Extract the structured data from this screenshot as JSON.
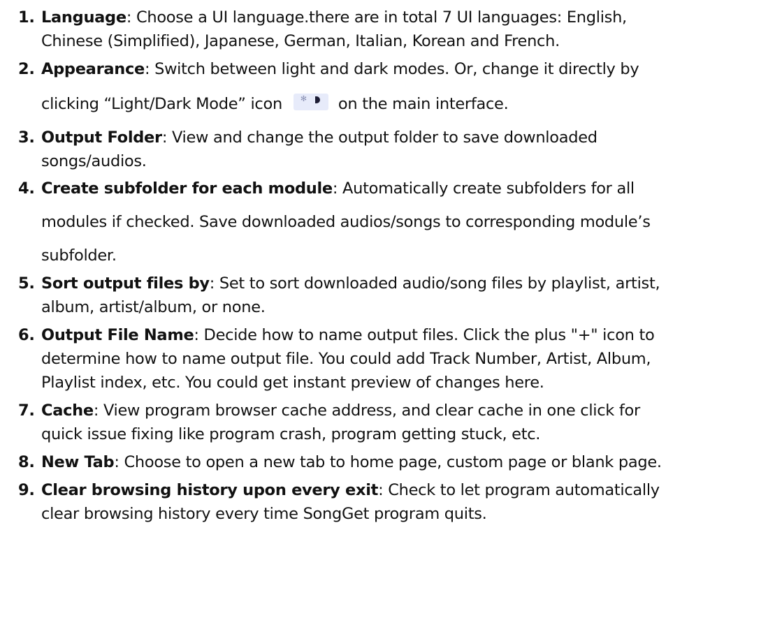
{
  "items": [
    {
      "number": "1.",
      "term": "Language",
      "lines": [
        ": Choose a UI language.there are in total 7 UI languages: English,",
        "Chinese (Simplified), Japanese, German, Italian, Korean and French."
      ]
    },
    {
      "number": "2.",
      "term": "Appearance",
      "lines": [
        ": Switch between light and dark modes. Or, change it directly by",
        "clicking “Light/Dark Mode” icon",
        "on the main interface."
      ],
      "icon": "light-dark-mode-toggle-icon"
    },
    {
      "number": "3.",
      "term": "Output Folder",
      "lines": [
        ": View and change the output folder to save downloaded",
        "songs/audios."
      ]
    },
    {
      "number": "4.",
      "term": "Create subfolder for each module",
      "lines": [
        ": Automatically create subfolders for all",
        "modules if checked. Save downloaded audios/songs to corresponding module’s",
        "subfolder."
      ]
    },
    {
      "number": "5.",
      "term": "Sort output files by",
      "lines": [
        ": Set to sort downloaded audio/song files by playlist, artist,",
        "album, artist/album, or none."
      ]
    },
    {
      "number": "6.",
      "term": "Output File Name",
      "lines": [
        ": Decide how to name output files. Click the plus \"+\" icon to",
        "determine how to name output file. You could add Track Number, Artist, Album,",
        "Playlist index, etc. You could get instant preview of changes here."
      ]
    },
    {
      "number": "7.",
      "term": "Cache",
      "lines": [
        ": View program browser cache address, and clear cache in one click for",
        "quick issue fixing like program crash, program getting stuck, etc."
      ]
    },
    {
      "number": "8.",
      "term": "New Tab",
      "lines": [
        ": Choose to open a new tab to home page, custom page or blank page."
      ]
    },
    {
      "number": "9.",
      "term": "Clear browsing history upon every exit",
      "lines": [
        ": Check to let program automatically",
        "clear browsing history every time SongGet program quits."
      ]
    }
  ]
}
